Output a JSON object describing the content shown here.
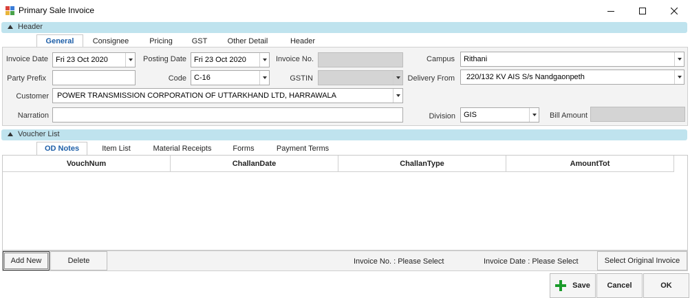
{
  "window": {
    "title": "Primary Sale Invoice",
    "minimize_icon": "minimize-icon",
    "maximize_icon": "maximize-icon",
    "close_icon": "close-icon"
  },
  "header_section": {
    "label": "Header",
    "tabs": [
      "General",
      "Consignee",
      "Pricing",
      "GST",
      "Other Detail",
      "Header"
    ],
    "active_tab": "General"
  },
  "form": {
    "invoice_date": {
      "label": "Invoice Date",
      "value": "Fri 23 Oct 2020"
    },
    "posting_date": {
      "label": "Posting Date",
      "value": "Fri 23 Oct 2020"
    },
    "invoice_no": {
      "label": "Invoice No.",
      "value": ""
    },
    "campus": {
      "label": "Campus",
      "value": "Rithani"
    },
    "party_prefix": {
      "label": "Party Prefix",
      "value": ""
    },
    "code": {
      "label": "Code",
      "value": "C-16"
    },
    "gstin": {
      "label": "GSTIN",
      "value": ""
    },
    "delivery_from": {
      "label": "Delivery From",
      "value": "220/132 KV AIS S/s Nandgaonpeth"
    },
    "customer": {
      "label": "Customer",
      "value": "POWER TRANSMISSION CORPORATION OF UTTARKHAND LTD, HARRAWALA"
    },
    "narration": {
      "label": "Narration",
      "value": ""
    },
    "division": {
      "label": "Division",
      "value": "GIS"
    },
    "bill_amount": {
      "label": "Bill Amount",
      "value": ""
    }
  },
  "voucher_section": {
    "label": "Voucher List",
    "tabs": [
      "OD Notes",
      "Item List",
      "Material Receipts",
      "Forms",
      "Payment Terms"
    ],
    "active_tab": "OD Notes"
  },
  "grid": {
    "columns": [
      "VouchNum",
      "ChallanDate",
      "ChallanType",
      "AmountTot"
    ],
    "rows": []
  },
  "footer": {
    "add_new": "Add New",
    "delete": "Delete",
    "invoice_no_label": "Invoice No. :",
    "invoice_no_value": "Please Select",
    "invoice_date_label": "Invoice Date :",
    "invoice_date_value": "Please Select",
    "select_original": "Select Original Invoice"
  },
  "actions": {
    "save": "Save",
    "cancel": "Cancel",
    "ok": "OK",
    "save_icon": "plus-icon"
  },
  "colors": {
    "section_bar": "#bfe3ee",
    "active_tab_text": "#1e5fa8",
    "save_icon": "#1a9b2a"
  }
}
